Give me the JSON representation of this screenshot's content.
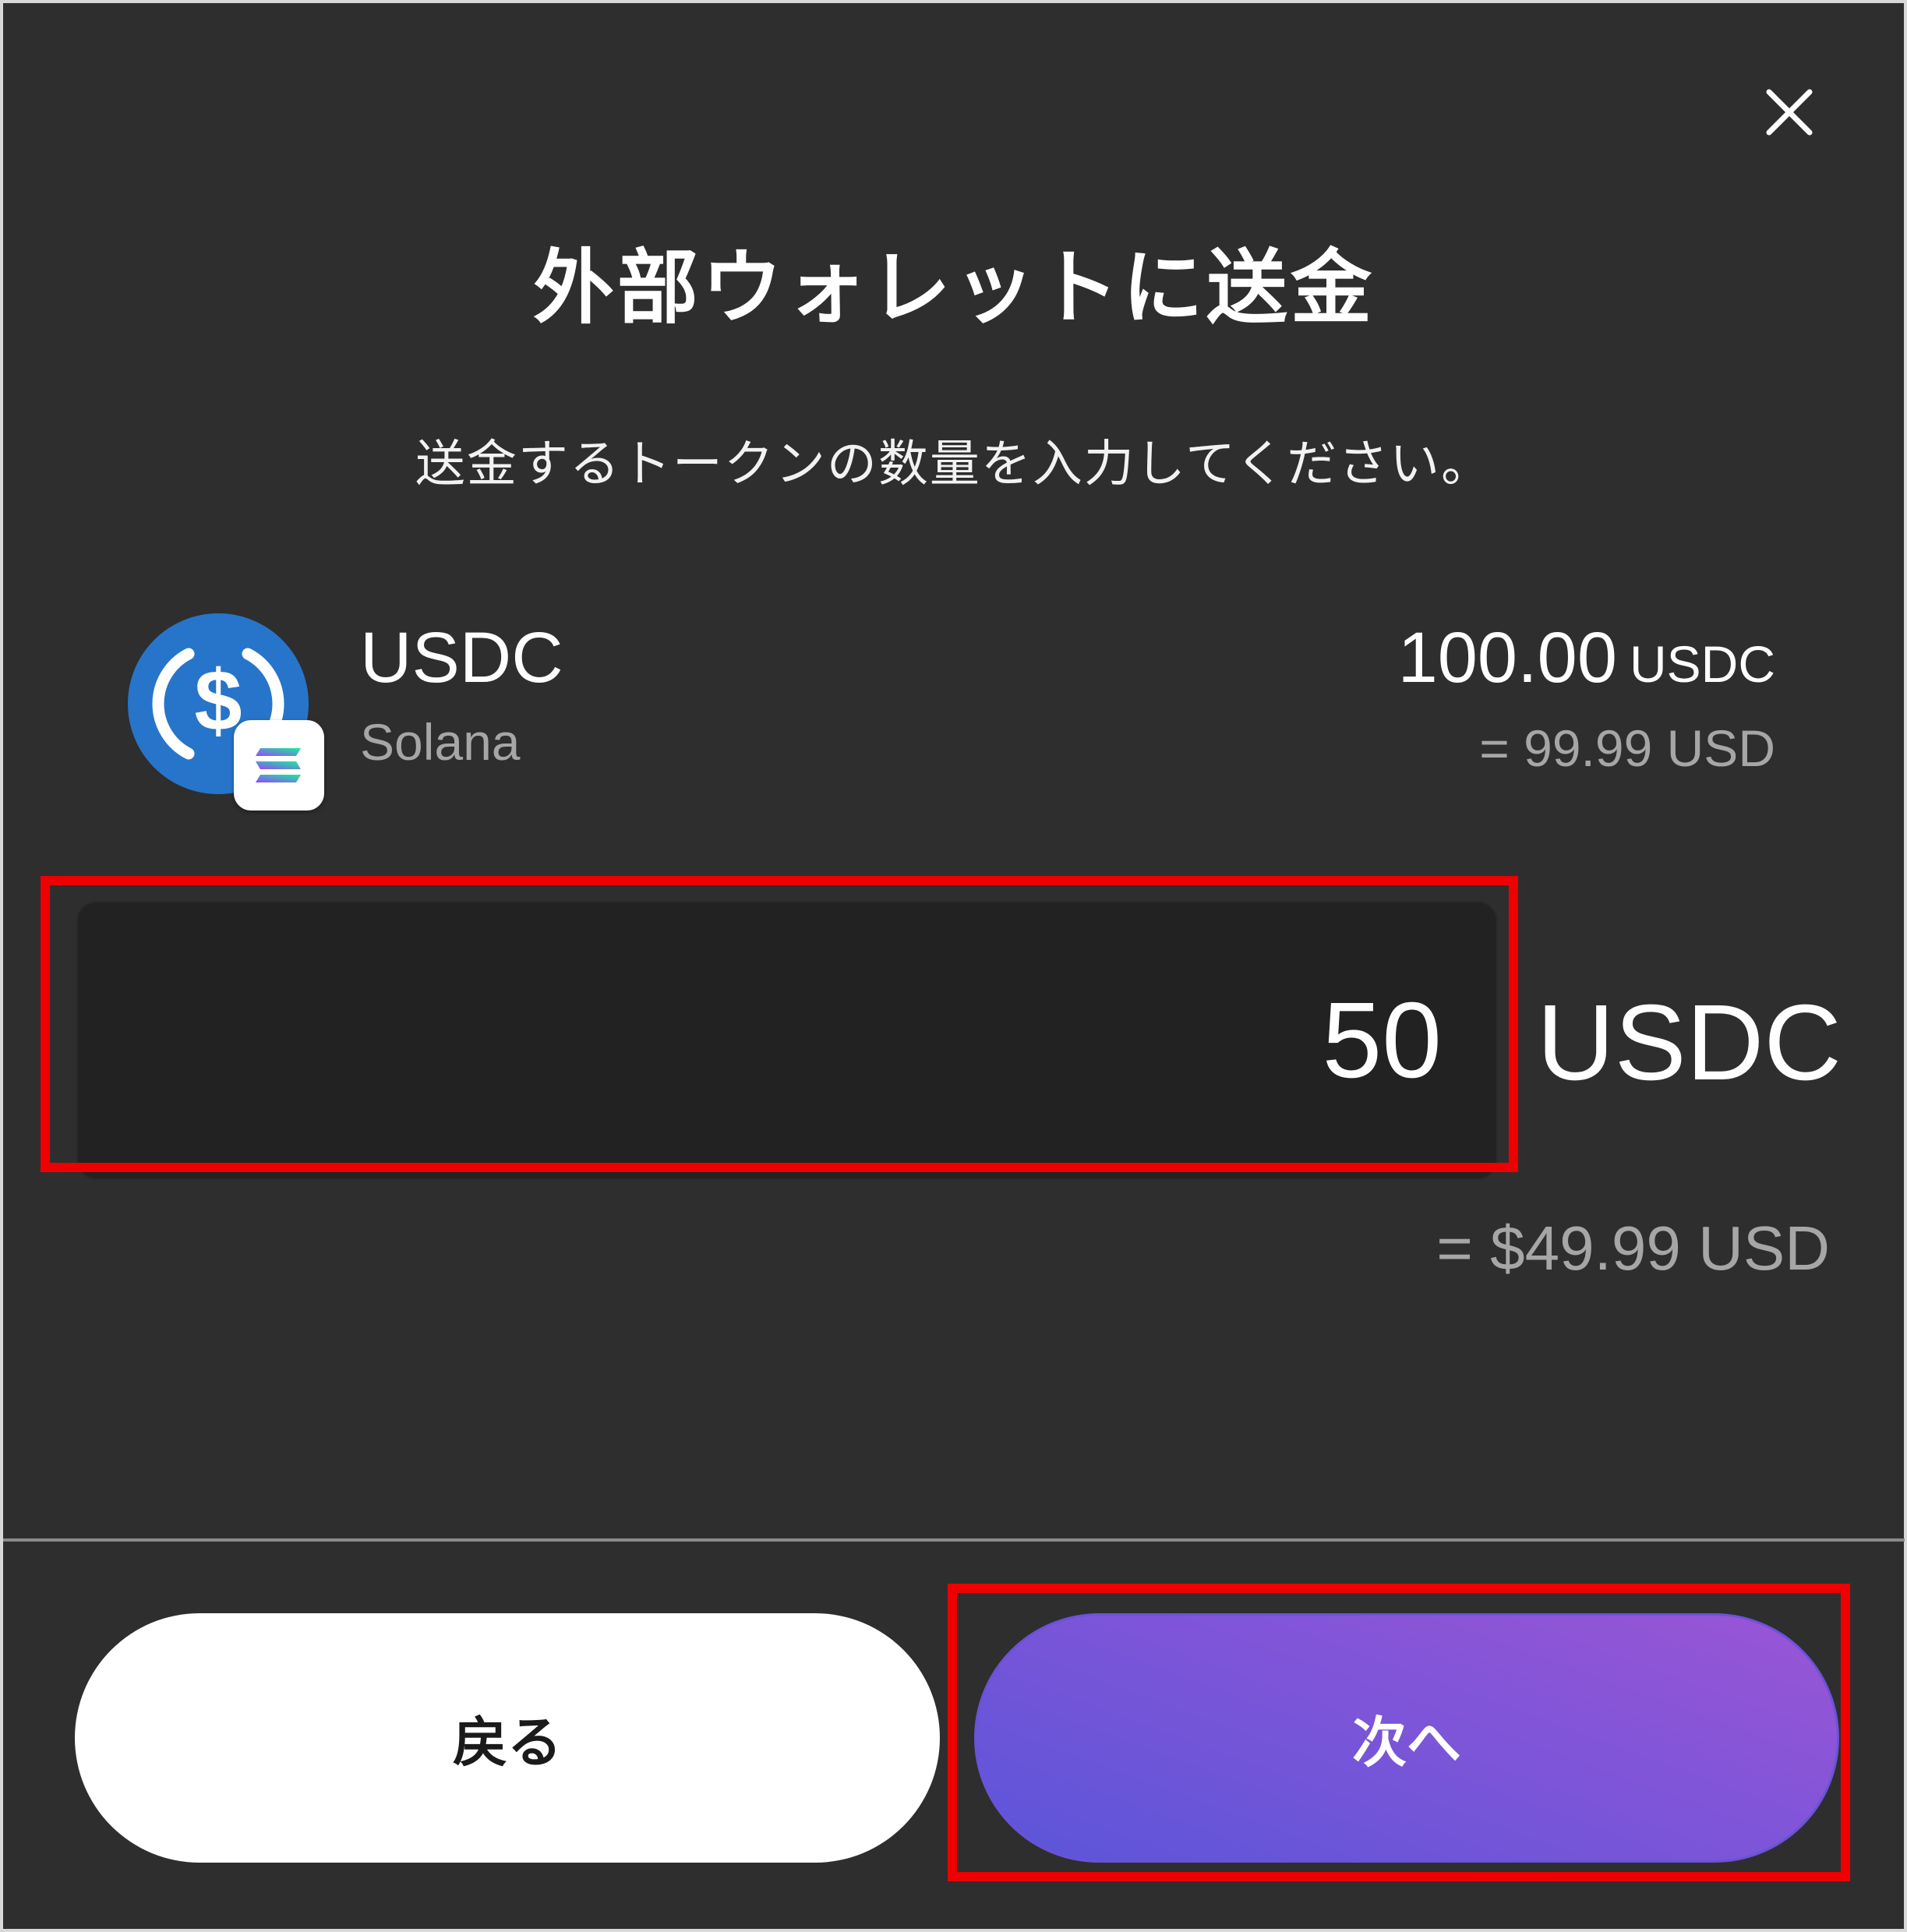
{
  "dialog": {
    "title": "外部ウォレットに送金",
    "subtitle": "送金するトークンの数量を入力してください。"
  },
  "token": {
    "name": "USDC",
    "network": "Solana",
    "icon": "usdc-icon",
    "chain_icon": "solana-icon",
    "brand_color": "#2775ca",
    "balance": "100.00",
    "balance_unit": "USDC",
    "balance_usd": "= 99.99 USD"
  },
  "amount": {
    "value": "50",
    "unit": "USDC",
    "usd_equivalent": "= $49.99 USD"
  },
  "buttons": {
    "back_label": "戻る",
    "next_label": "次へ"
  },
  "colors": {
    "background": "#2e2e2e",
    "input_background": "#222222",
    "highlight": "#ee0000",
    "next_gradient_start": "#5a55d9",
    "next_gradient_end": "#9a55d6"
  }
}
